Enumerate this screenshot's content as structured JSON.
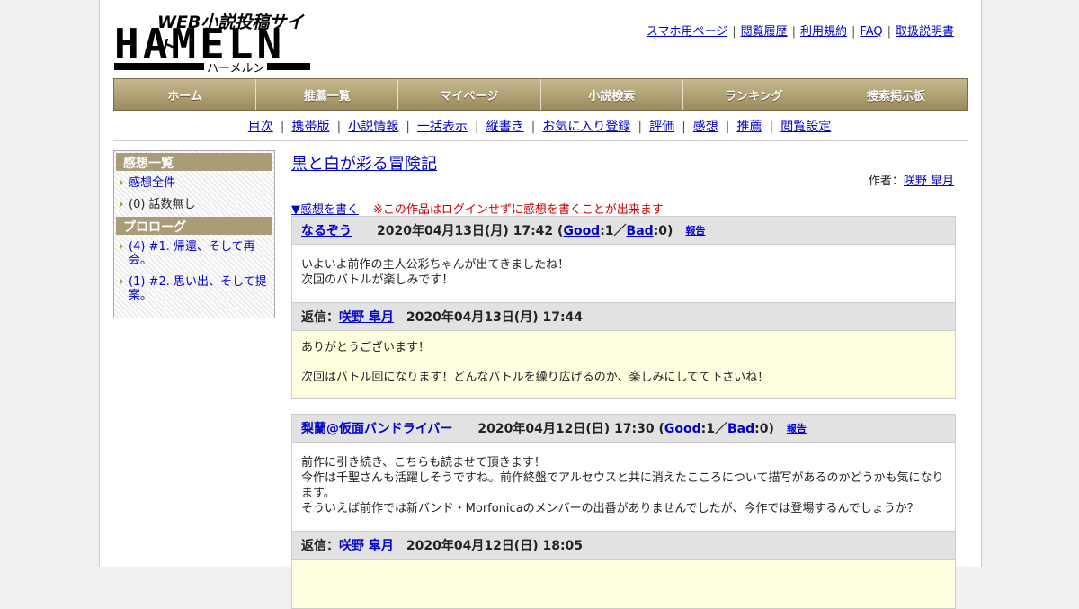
{
  "logo": {
    "tagline": "WEB小説投稿サイト",
    "name": "HAMELN",
    "kana": "ハーメルン"
  },
  "toplinks": [
    "スマホ用ページ",
    "閲覧履歴",
    "利用規約",
    "FAQ",
    "取扱説明書"
  ],
  "menu": [
    "ホーム",
    "推薦一覧",
    "マイページ",
    "小説検索",
    "ランキング",
    "捜索掲示板"
  ],
  "subnav": [
    "目次",
    "携帯版",
    "小説情報",
    "一括表示",
    "縦書き",
    "お気に入り登録",
    "評価",
    "感想",
    "推薦",
    "閲覧設定"
  ],
  "sidebar": {
    "header1": "感想一覧",
    "item_all": "感想全件",
    "item_none": "(0) 話数無し",
    "header2": "プロローグ",
    "ep1": "(4) #1. 帰還、そして再会。",
    "ep2": "(1) #2. 思い出、そして提案。"
  },
  "main": {
    "title": "黒と白が彩る冒険記",
    "author_label": "作者：",
    "author": "咲野 皐月",
    "write_link": "▼感想を書く",
    "warning": "※この作品はログインせずに感想を書くことが出来ます"
  },
  "comments": [
    {
      "user": "なるぞう",
      "date": "2020年04月13日(月) 17:42",
      "open": "(",
      "good_label": "Good",
      "good": ":1／",
      "bad_label": "Bad",
      "bad": ":0)",
      "report": "報告",
      "body1": "いよいよ前作の主人公彩ちゃんが出てきましたね！",
      "body2": "次回のバトルが楽しみです！",
      "reply_label": "返信：",
      "reply_user": "咲野 皐月",
      "reply_date": "2020年04月13日(月) 17:44",
      "reply1": "ありがとうございます！",
      "reply2": "次回はバトル回になります！どんなバトルを繰り広げるのか、楽しみにしてて下さいね！"
    },
    {
      "user": "梨蘭@仮面バンドライバー",
      "date": "2020年04月12日(日) 17:30",
      "open": "(",
      "good_label": "Good",
      "good": ":1／",
      "bad_label": "Bad",
      "bad": ":0)",
      "report": "報告",
      "body1": "前作に引き続き、こちらも読ませて頂きます！",
      "body2": "今作は千聖さんも活躍しそうですね。前作終盤でアルセウスと共に消えたこころについて描写があるのかどうかも気になります。",
      "body3": "そういえば前作では新バンド・Morfonicaのメンバーの出番がありませんでしたが、今作では登場するんでしょうか？",
      "reply_label": "返信：",
      "reply_user": "咲野 皐月",
      "reply_date": "2020年04月12日(日) 18:05"
    }
  ]
}
